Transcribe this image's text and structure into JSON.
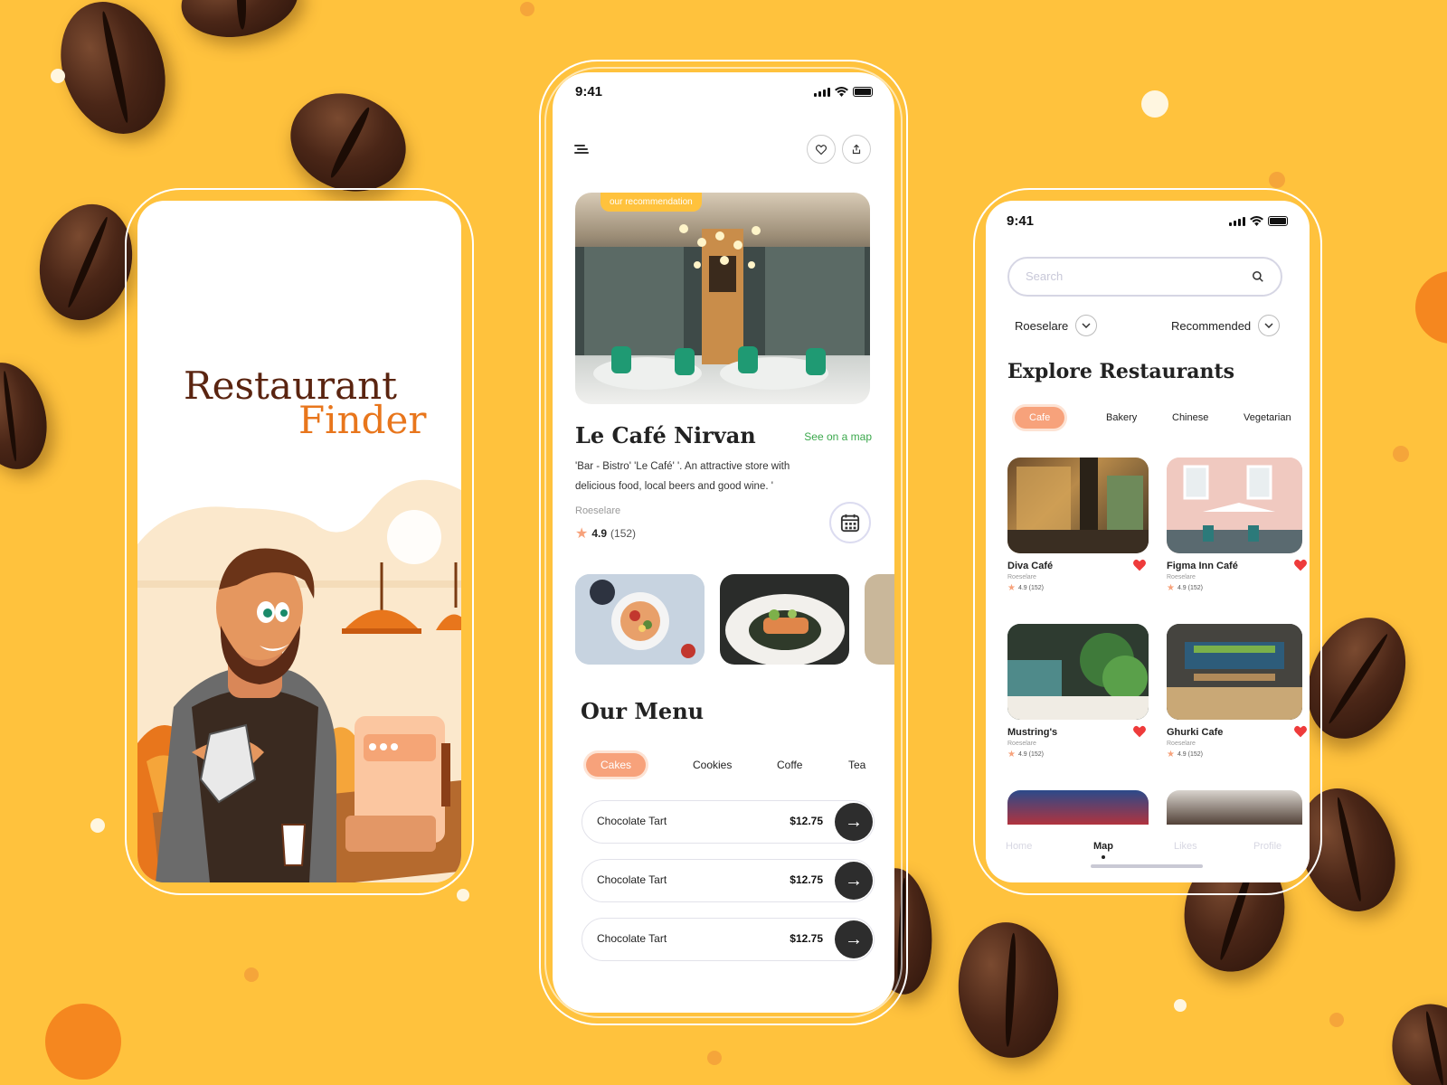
{
  "colors": {
    "background": "#FFC23D",
    "brand_brown": "#5A2410",
    "brand_orange": "#E8761C",
    "tab_active": "#F7A27B",
    "link_green": "#3BA84C",
    "heart_red": "#EE3B3B"
  },
  "splash": {
    "title_line1": "Restaurant",
    "title_line2": "Finder"
  },
  "detail": {
    "status_time": "9:41",
    "menu_icon": "hamburger-icon",
    "favorite_icon": "heart-outline-icon",
    "share_icon": "share-icon",
    "badge": "our recommendation",
    "name": "Le Café Nirvan",
    "map_link": "See on a map",
    "description": "'Bar - Bistro' 'Le Café' '. An attractive store with delicious food, local beers and good wine. '",
    "location": "Roeselare",
    "rating": "4.9",
    "reviews": "(152)",
    "calendar_icon": "calendar-icon",
    "menu_heading": "Our Menu",
    "menu_tabs": [
      "Cakes",
      "Cookies",
      "Coffe",
      "Tea"
    ],
    "menu_items": [
      {
        "name": "Chocolate Tart",
        "price": "$12.75"
      },
      {
        "name": "Chocolate Tart",
        "price": "$12.75"
      },
      {
        "name": "Chocolate Tart",
        "price": "$12.75"
      }
    ]
  },
  "explore": {
    "status_time": "9:41",
    "search_placeholder": "Search",
    "location_filter": "Roeselare",
    "sort_filter": "Recommended",
    "heading": "Explore Restaurants",
    "categories": [
      "Cafe",
      "Bakery",
      "Chinese",
      "Vegetarian"
    ],
    "restaurants": [
      {
        "name": "Diva Café",
        "location": "Roeselare",
        "rating": "4.9 (152)"
      },
      {
        "name": "Figma Inn Café",
        "location": "Roeselare",
        "rating": "4.9 (152)"
      },
      {
        "name": "Mustring's",
        "location": "Roeselare",
        "rating": "4.9 (152)"
      },
      {
        "name": "Ghurki Cafe",
        "location": "Roeselare",
        "rating": "4.9 (152)"
      }
    ],
    "nav": [
      "Home",
      "Map",
      "Likes",
      "Profile"
    ]
  }
}
